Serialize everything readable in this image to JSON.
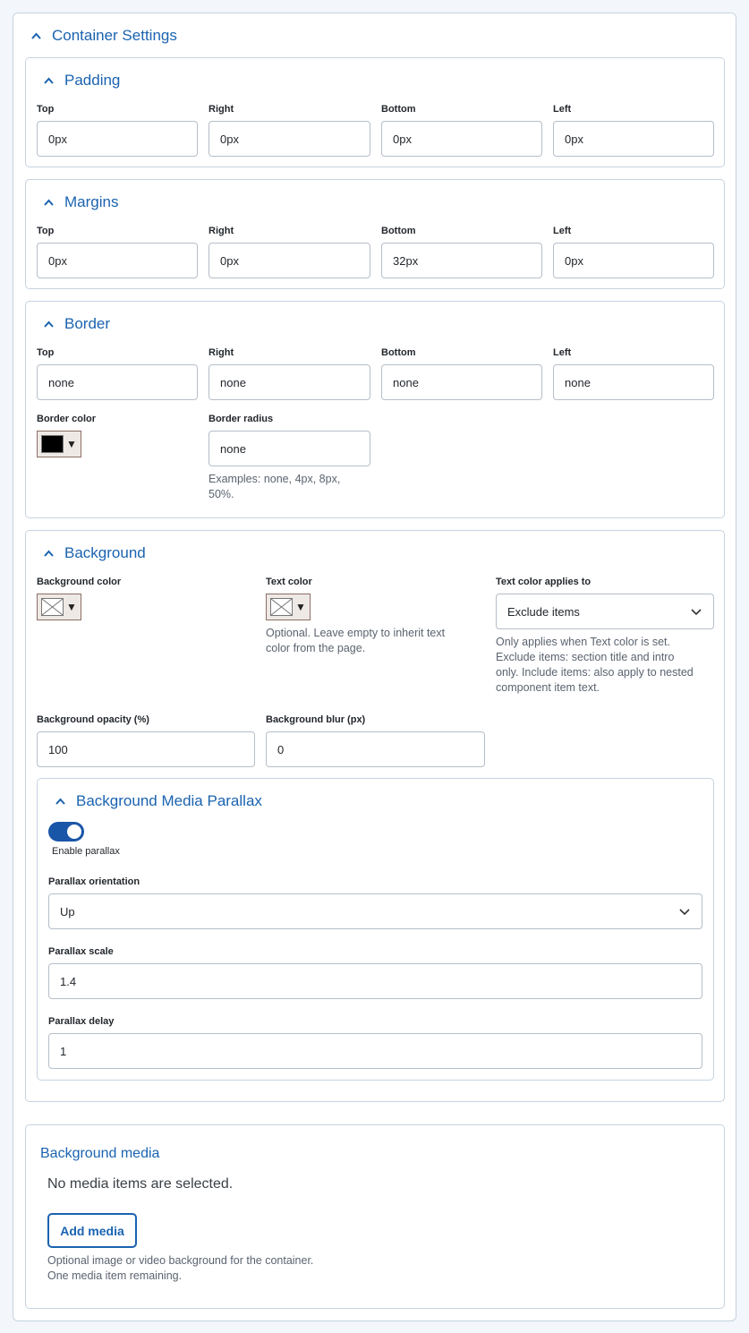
{
  "container": {
    "title": "Container Settings"
  },
  "padding": {
    "title": "Padding",
    "fields": [
      {
        "label": "Top",
        "value": "0px"
      },
      {
        "label": "Right",
        "value": "0px"
      },
      {
        "label": "Bottom",
        "value": "0px"
      },
      {
        "label": "Left",
        "value": "0px"
      }
    ]
  },
  "margins": {
    "title": "Margins",
    "fields": [
      {
        "label": "Top",
        "value": "0px"
      },
      {
        "label": "Right",
        "value": "0px"
      },
      {
        "label": "Bottom",
        "value": "32px"
      },
      {
        "label": "Left",
        "value": "0px"
      }
    ]
  },
  "border": {
    "title": "Border",
    "fields": [
      {
        "label": "Top",
        "value": "none"
      },
      {
        "label": "Right",
        "value": "none"
      },
      {
        "label": "Bottom",
        "value": "none"
      },
      {
        "label": "Left",
        "value": "none"
      }
    ],
    "color_label": "Border color",
    "color_value": "#000000",
    "radius_label": "Border radius",
    "radius_value": "none",
    "radius_help_1": "Examples: none, 4px, 8px,",
    "radius_help_2": "50%."
  },
  "background": {
    "title": "Background",
    "bg_color_label": "Background color",
    "text_color_label": "Text color",
    "text_color_help_1": "Optional. Leave empty to inherit text",
    "text_color_help_2": "color from the page.",
    "applies_label": "Text color applies to",
    "applies_value": "Exclude items",
    "applies_help_1": "Only applies when Text color is set.",
    "applies_help_2": "Exclude items: section title and intro",
    "applies_help_3": "only. Include items: also apply to nested",
    "applies_help_4": "component item text.",
    "opacity_label": "Background opacity (%)",
    "opacity_value": "100",
    "blur_label": "Background blur (px)",
    "blur_value": "0"
  },
  "parallax": {
    "title": "Background Media Parallax",
    "enabled": true,
    "enable_label": "Enable parallax",
    "orientation_label": "Parallax orientation",
    "orientation_value": "Up",
    "scale_label": "Parallax scale",
    "scale_value": "1.4",
    "delay_label": "Parallax delay",
    "delay_value": "1"
  },
  "media": {
    "title": "Background media",
    "empty_text": "No media items are selected.",
    "add_button": "Add media",
    "help_1": "Optional image or video background for the container.",
    "help_2": "One media item remaining."
  },
  "colors": {
    "accent": "#1a63b0",
    "toggle": "#1a56a8",
    "border": "#c6d3e0"
  }
}
